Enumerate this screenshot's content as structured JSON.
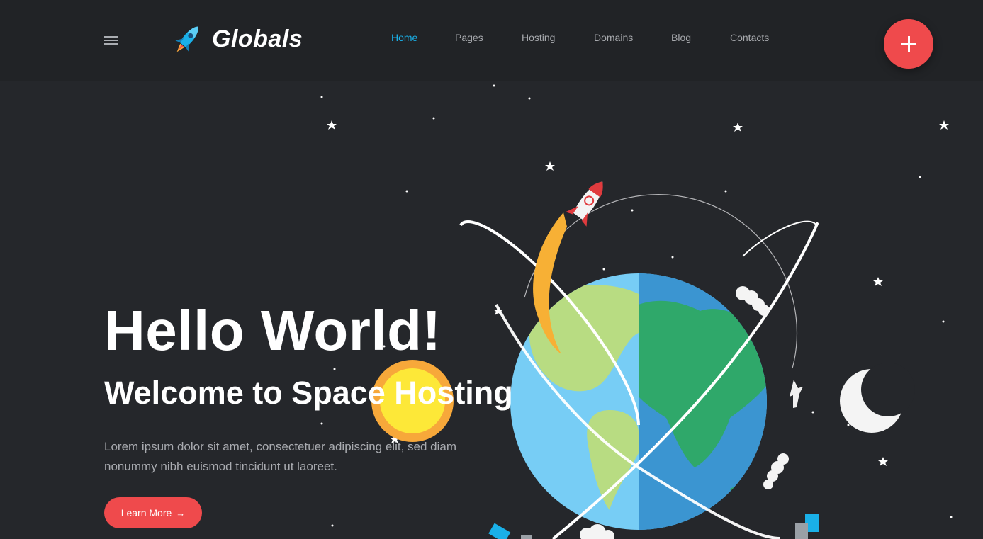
{
  "header": {
    "brand": "Globals",
    "nav": [
      {
        "label": "Home",
        "active": true
      },
      {
        "label": "Pages",
        "active": false
      },
      {
        "label": "Hosting",
        "active": false
      },
      {
        "label": "Domains",
        "active": false
      },
      {
        "label": "Blog",
        "active": false
      },
      {
        "label": "Contacts",
        "active": false
      }
    ],
    "fab_icon": "plus-icon",
    "menu_icon": "hamburger-menu-icon"
  },
  "hero": {
    "title": "Hello World!",
    "subtitle": "Welcome to Space Hosting",
    "text": "Lorem ipsum dolor sit amet, consectetuer adipiscing elit, sed diam nonummy nibh euismod tincidunt ut laoreet.",
    "button_label": "Learn More",
    "button_icon": "arrow-right-icon"
  },
  "colors": {
    "background": "#25272b",
    "header": "#212326",
    "accent": "#ef4a4c",
    "active_link": "#1ab0e8"
  }
}
